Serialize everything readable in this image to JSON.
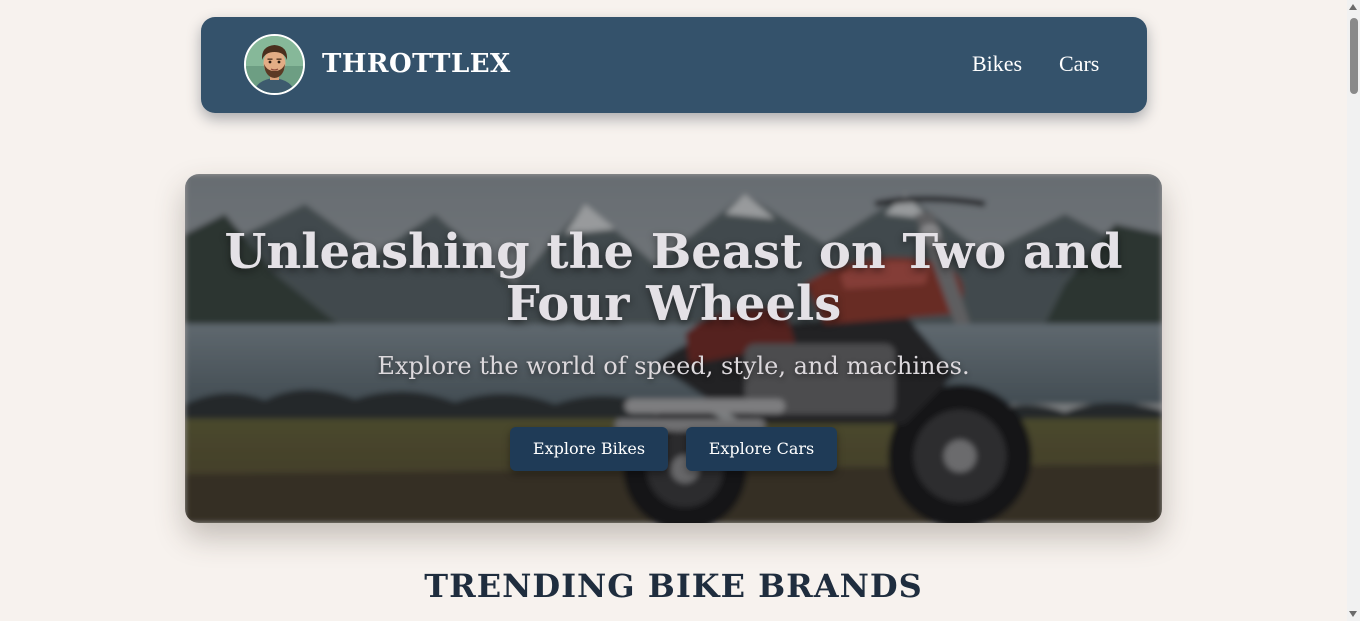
{
  "navbar": {
    "brand": "THROTTLEX",
    "links": [
      "Bikes",
      "Cars"
    ]
  },
  "hero": {
    "title": "Unleashing the Beast on Two and Four Wheels",
    "subtitle": "Explore the world of speed, style, and machines.",
    "buttons": [
      "Explore Bikes",
      "Explore Cars"
    ]
  },
  "sections": {
    "trending_title": "TRENDING BIKE BRANDS"
  },
  "colors": {
    "page_bg": "#f7f2ee",
    "navbar_bg": "#34526b",
    "button_bg": "#1f3b57",
    "heading": "#1f2d3e"
  },
  "icons": {
    "avatar": "cartoon-man-avatar",
    "hero_image": "motorcycle-by-lake-photo"
  }
}
